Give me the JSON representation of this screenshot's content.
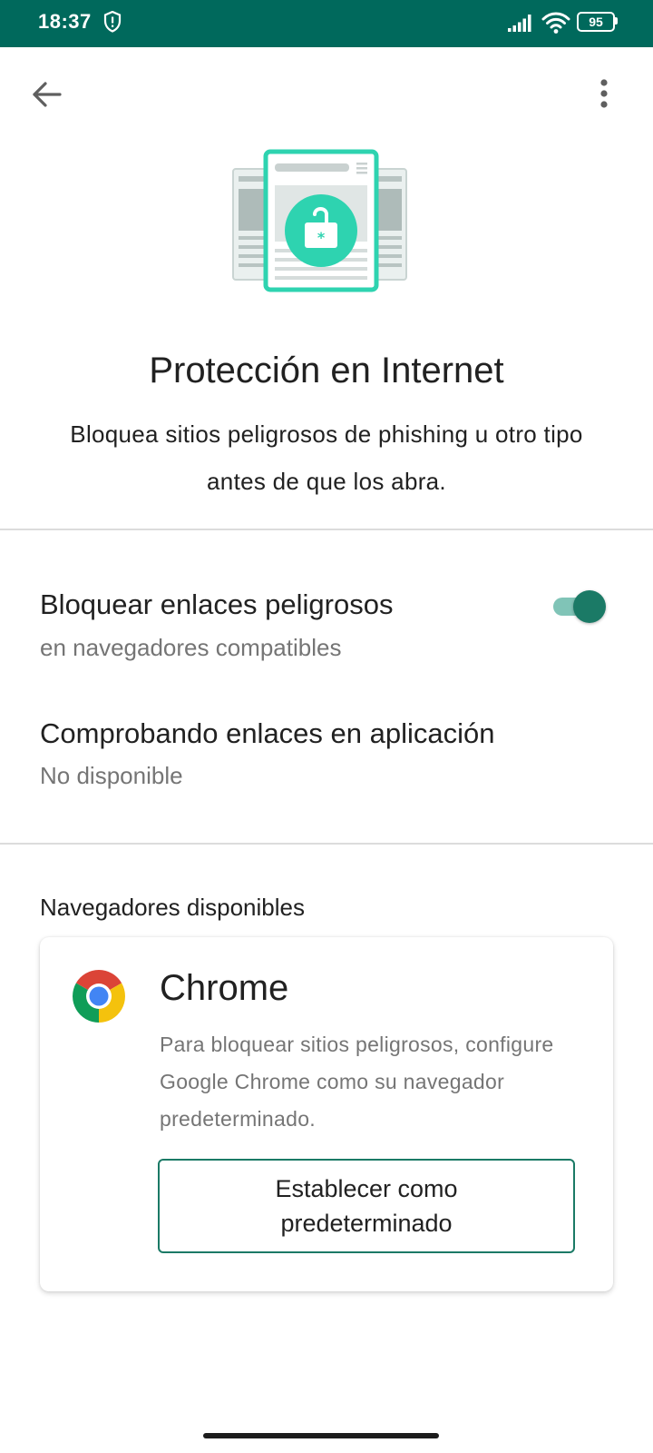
{
  "status_bar": {
    "time": "18:37",
    "battery": "95",
    "background": "#00695c"
  },
  "toolbar": {
    "back_icon": "arrow-left-icon",
    "more_icon": "more-vert-icon"
  },
  "header": {
    "illustration": "web-protection-lock-illustration",
    "title": "Protección en Internet",
    "subtitle": "Bloquea sitios peligrosos de phishing u otro tipo antes de que los abra."
  },
  "settings": [
    {
      "title": "Bloquear enlaces peligrosos",
      "subtitle": "en navegadores compatibles",
      "toggle_on": true
    },
    {
      "title": "Comprobando enlaces en aplicación",
      "subtitle": "No disponible"
    }
  ],
  "browsers": {
    "section_title": "Navegadores disponibles",
    "items": [
      {
        "name": "Chrome",
        "icon": "chrome-logo-icon",
        "description": "Para bloquear sitios peligrosos, configure Google Chrome como su navegador predeterminado.",
        "button_label": "Establecer como predeterminado"
      }
    ]
  },
  "colors": {
    "accent": "#1b7a66",
    "illustration_teal": "#2ed3b0",
    "secondary_text": "#757575"
  }
}
